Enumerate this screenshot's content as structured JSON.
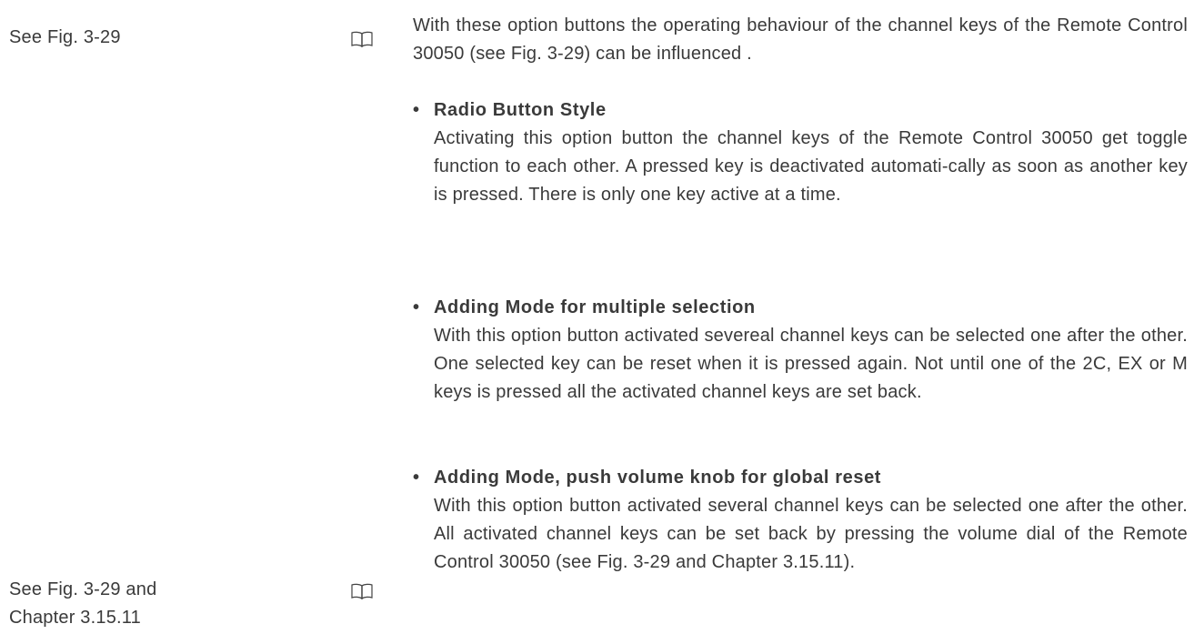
{
  "margin_notes": [
    {
      "lines": [
        "See Fig. 3-29"
      ]
    },
    {
      "lines": [
        "See Fig. 3-29 and",
        "Chapter 3.15.11"
      ]
    }
  ],
  "icons": [
    "book-icon",
    "book-icon"
  ],
  "intro": "With these option buttons the operating behaviour of the channel keys of the Remote Control 30050 (see Fig. 3-29) can be influenced .",
  "options": [
    {
      "bullet": "•",
      "title": "Radio Button Style",
      "body": "Activating this option button the channel keys of the Remote Control 30050 get toggle function to each other. A pressed key is deactivated automati-cally as soon as another key is pressed. There is only one key active at a time."
    },
    {
      "bullet": "•",
      "title": "Adding Mode for multiple selection",
      "body": "With this option button activated severeal channel keys can be selected one after the other. One selected key can be reset when it is pressed again. Not until one of the 2C, EX or M keys is pressed all the activated channel keys are set back."
    },
    {
      "bullet": "•",
      "title": "Adding Mode, push volume knob for global reset",
      "body": "With this option button activated several channel keys can be selected one after the other. All activated channel keys can be set back by pressing the volume dial of the Remote Control 30050 (see Fig. 3-29 and Chapter 3.15.11)."
    }
  ]
}
